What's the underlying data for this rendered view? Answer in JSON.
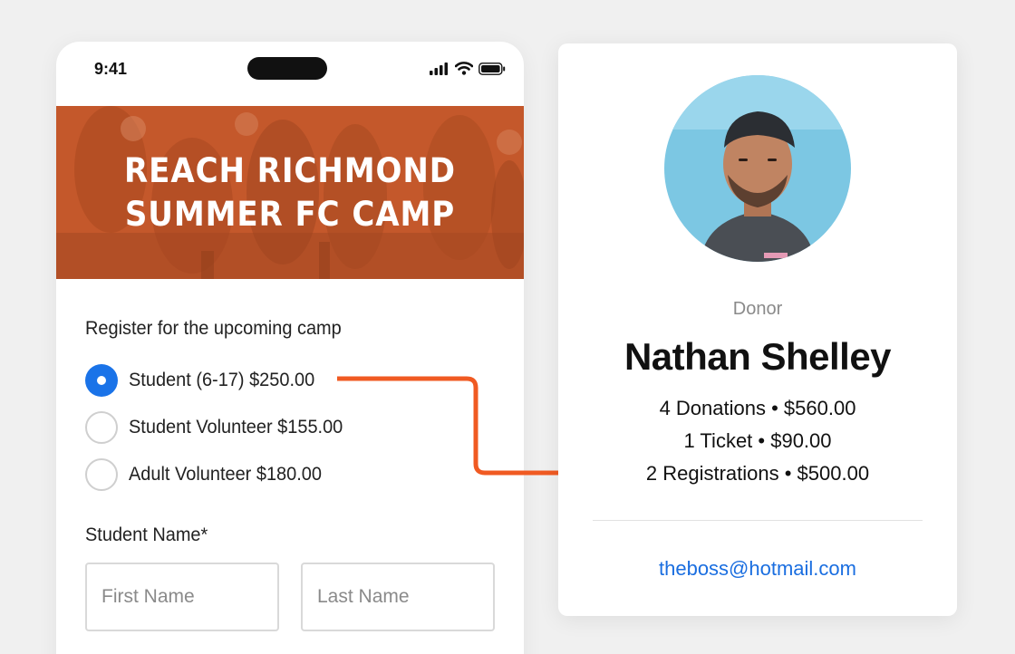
{
  "phone": {
    "status": {
      "time": "9:41"
    },
    "hero": {
      "title_line1": "REACH RICHMOND",
      "title_line2": "SUMMER FC CAMP"
    },
    "form": {
      "heading": "Register for the upcoming camp",
      "options": [
        {
          "label": "Student (6-17) $250.00",
          "selected": true
        },
        {
          "label": "Student Volunteer $155.00",
          "selected": false
        },
        {
          "label": "Adult Volunteer $180.00",
          "selected": false
        }
      ],
      "name_label": "Student Name*",
      "first_name_placeholder": "First Name",
      "last_name_placeholder": "Last Name"
    }
  },
  "donor": {
    "role": "Donor",
    "name": "Nathan Shelley",
    "stats": [
      "4 Donations  •  $560.00",
      "1 Ticket  •  $90.00",
      "2 Registrations • $500.00"
    ],
    "email": "theboss@hotmail.com"
  },
  "colors": {
    "accent": "#1a73e8",
    "hero": "#c4582b",
    "arrow": "#f05a22",
    "link": "#1a6ee0"
  },
  "icons": [
    "signal-icon",
    "wifi-icon",
    "battery-icon",
    "arrow-connector"
  ]
}
